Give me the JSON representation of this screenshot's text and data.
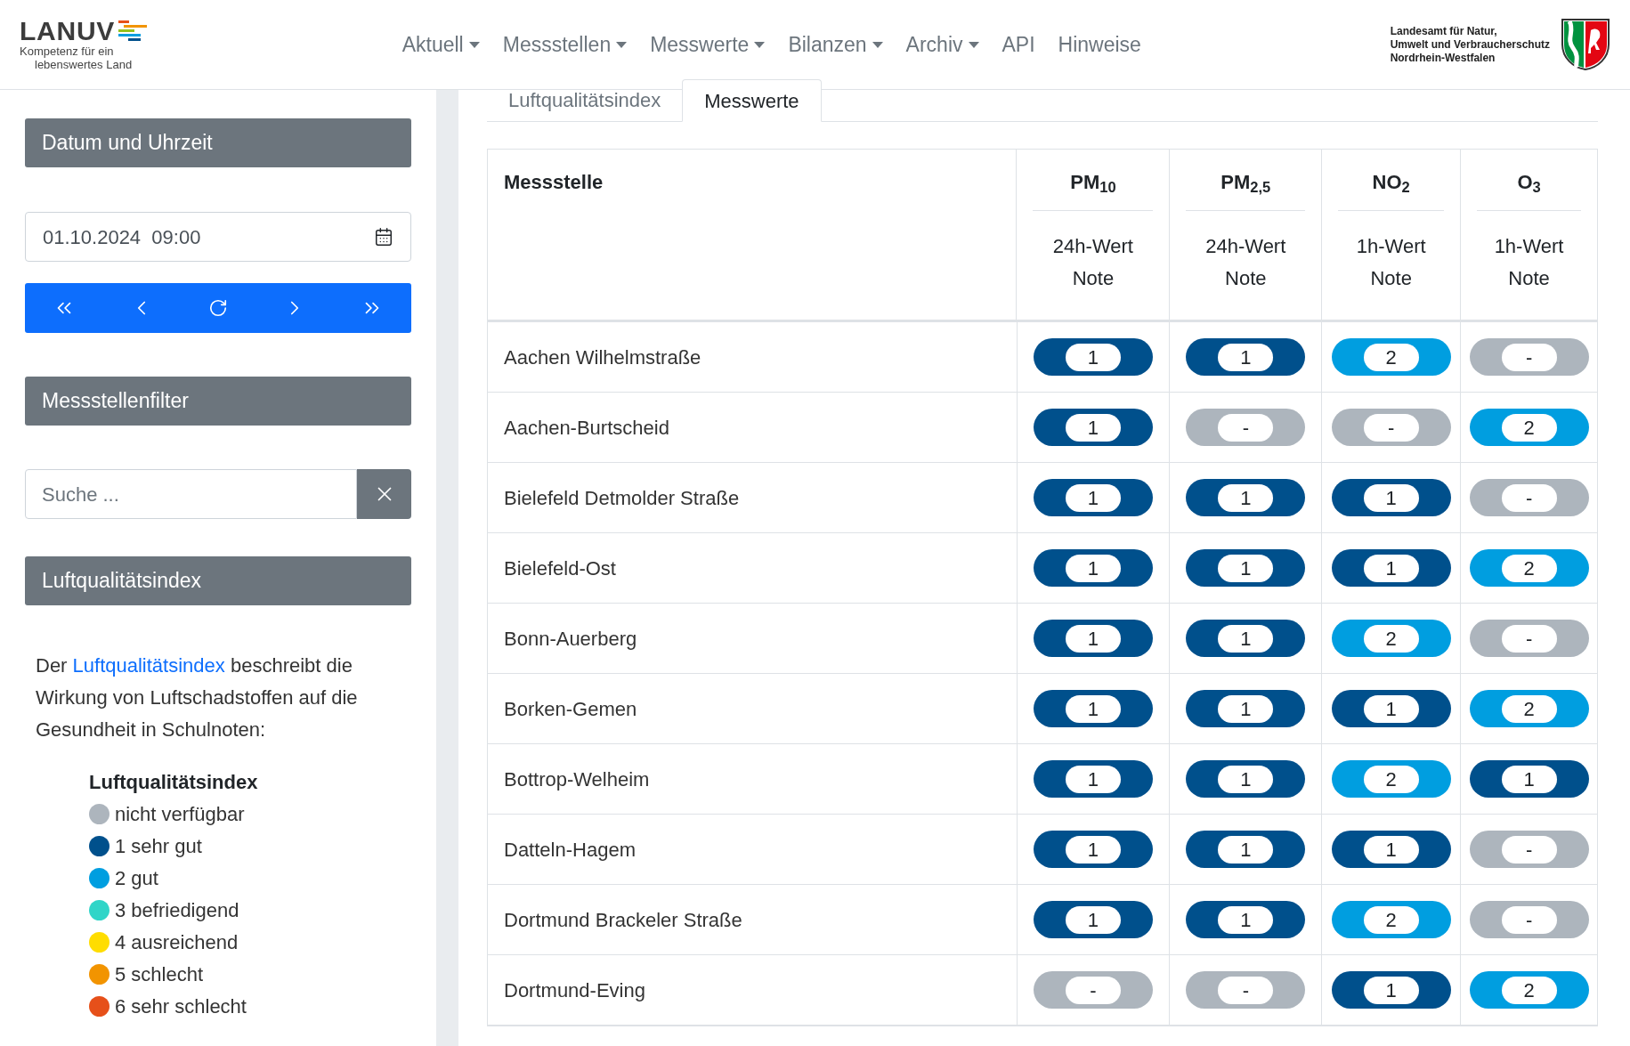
{
  "header": {
    "logo": {
      "name": "LANUV",
      "tagline_1": "Kompetenz für ein",
      "tagline_2": "lebenswertes Land"
    },
    "nav": [
      {
        "label": "Aktuell",
        "dropdown": true
      },
      {
        "label": "Messstellen",
        "dropdown": true
      },
      {
        "label": "Messwerte",
        "dropdown": true
      },
      {
        "label": "Bilanzen",
        "dropdown": true
      },
      {
        "label": "Archiv",
        "dropdown": true
      },
      {
        "label": "API",
        "dropdown": false
      },
      {
        "label": "Hinweise",
        "dropdown": false
      }
    ],
    "agency": [
      "Landesamt für Natur,",
      "Umwelt und Verbraucherschutz",
      "Nordrhein-Westfalen"
    ]
  },
  "sidebar": {
    "date_heading": "Datum und Uhrzeit",
    "date_value": "01.10.2024  09:00",
    "filter_heading": "Messstellenfilter",
    "search": {
      "placeholder": "Suche ..."
    },
    "index_heading": "Luftqualitätsindex",
    "description": {
      "before": "Der",
      "link": "Luftqualitätsindex",
      "after": "beschreibt die Wirkung von Luftschadstoffen auf die Gesundheit in Schulnoten:"
    },
    "legend": {
      "title": "Luftqualitätsindex",
      "items": [
        {
          "label": "nicht verfügbar",
          "color": "#adb5bd"
        },
        {
          "label": "1 sehr gut",
          "color": "#00508c"
        },
        {
          "label": "2 gut",
          "color": "#009ee0"
        },
        {
          "label": "3 befriedigend",
          "color": "#30d5c8"
        },
        {
          "label": "4 ausreichend",
          "color": "#ffdd00"
        },
        {
          "label": "5 schlecht",
          "color": "#f29400"
        },
        {
          "label": "6 sehr schlecht",
          "color": "#e6501a"
        }
      ]
    }
  },
  "tabs": [
    {
      "label": "Luftqualitätsindex",
      "selected": false
    },
    {
      "label": "Messwerte",
      "selected": true
    }
  ],
  "table": {
    "first_column": "Messstelle",
    "columns": [
      {
        "name": "PM$_{10}$",
        "period": "24h-Wert",
        "unit": "Note"
      },
      {
        "name": "PM$_{2,5}$",
        "period": "24h-Wert",
        "unit": "Note"
      },
      {
        "name": "NO$_{2}$",
        "period": "1h-Wert",
        "unit": "Note"
      },
      {
        "name": "O$_{3}$",
        "period": "1h-Wert",
        "unit": "Note"
      }
    ],
    "rows": [
      {
        "station": "Aachen Wilhelmstraße",
        "cells": [
          {
            "value": "1",
            "color": "#00508c"
          },
          {
            "value": "1",
            "color": "#00508c"
          },
          {
            "value": "2",
            "color": "#009ee0"
          },
          {
            "value": "-",
            "color": "#adb5bd"
          }
        ]
      },
      {
        "station": "Aachen-Burtscheid",
        "cells": [
          {
            "value": "1",
            "color": "#00508c"
          },
          {
            "value": "-",
            "color": "#adb5bd"
          },
          {
            "value": "-",
            "color": "#adb5bd"
          },
          {
            "value": "2",
            "color": "#009ee0"
          }
        ]
      },
      {
        "station": "Bielefeld Detmolder Straße",
        "cells": [
          {
            "value": "1",
            "color": "#00508c"
          },
          {
            "value": "1",
            "color": "#00508c"
          },
          {
            "value": "1",
            "color": "#00508c"
          },
          {
            "value": "-",
            "color": "#adb5bd"
          }
        ]
      },
      {
        "station": "Bielefeld-Ost",
        "cells": [
          {
            "value": "1",
            "color": "#00508c"
          },
          {
            "value": "1",
            "color": "#00508c"
          },
          {
            "value": "1",
            "color": "#00508c"
          },
          {
            "value": "2",
            "color": "#009ee0"
          }
        ]
      },
      {
        "station": "Bonn-Auerberg",
        "cells": [
          {
            "value": "1",
            "color": "#00508c"
          },
          {
            "value": "1",
            "color": "#00508c"
          },
          {
            "value": "2",
            "color": "#009ee0"
          },
          {
            "value": "-",
            "color": "#adb5bd"
          }
        ]
      },
      {
        "station": "Borken-Gemen",
        "cells": [
          {
            "value": "1",
            "color": "#00508c"
          },
          {
            "value": "1",
            "color": "#00508c"
          },
          {
            "value": "1",
            "color": "#00508c"
          },
          {
            "value": "2",
            "color": "#009ee0"
          }
        ]
      },
      {
        "station": "Bottrop-Welheim",
        "cells": [
          {
            "value": "1",
            "color": "#00508c"
          },
          {
            "value": "1",
            "color": "#00508c"
          },
          {
            "value": "2",
            "color": "#009ee0"
          },
          {
            "value": "1",
            "color": "#00508c"
          }
        ]
      },
      {
        "station": "Datteln-Hagem",
        "cells": [
          {
            "value": "1",
            "color": "#00508c"
          },
          {
            "value": "1",
            "color": "#00508c"
          },
          {
            "value": "1",
            "color": "#00508c"
          },
          {
            "value": "-",
            "color": "#adb5bd"
          }
        ]
      },
      {
        "station": "Dortmund Brackeler Straße",
        "cells": [
          {
            "value": "1",
            "color": "#00508c"
          },
          {
            "value": "1",
            "color": "#00508c"
          },
          {
            "value": "2",
            "color": "#009ee0"
          },
          {
            "value": "-",
            "color": "#adb5bd"
          }
        ]
      },
      {
        "station": "Dortmund-Eving",
        "cells": [
          {
            "value": "-",
            "color": "#adb5bd"
          },
          {
            "value": "-",
            "color": "#adb5bd"
          },
          {
            "value": "1",
            "color": "#00508c"
          },
          {
            "value": "2",
            "color": "#009ee0"
          }
        ]
      }
    ]
  }
}
